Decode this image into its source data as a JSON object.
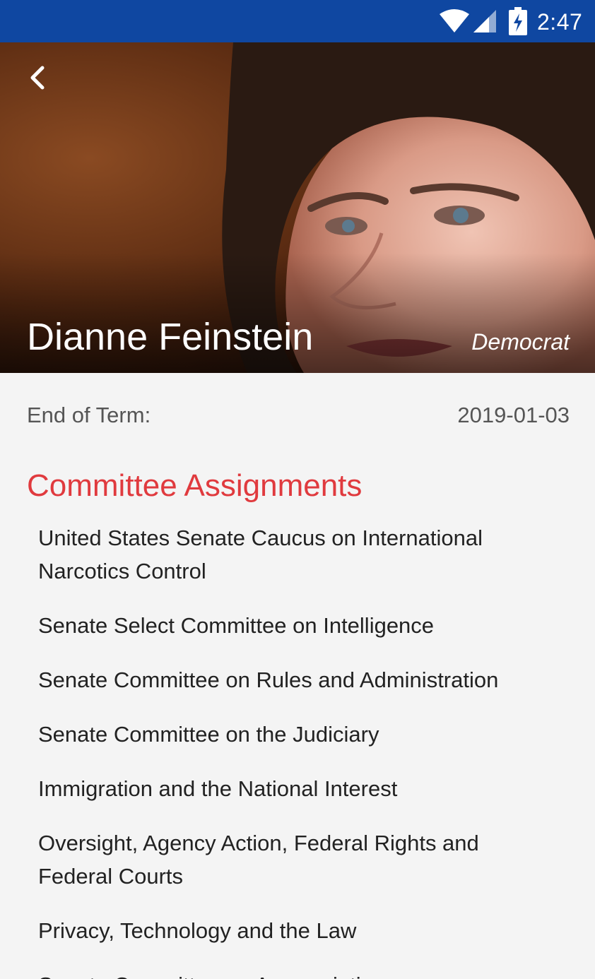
{
  "status_bar": {
    "time": "2:47",
    "icons": [
      "wifi-icon",
      "cell-signal-icon",
      "battery-charging-icon"
    ],
    "color": "#0f47a1"
  },
  "header": {
    "back_icon": "chevron-left-icon",
    "name": "Dianne Feinstein",
    "party": "Democrat"
  },
  "details": {
    "end_of_term_label": "End of Term:",
    "end_of_term_value": "2019-01-03"
  },
  "committees": {
    "title": "Committee Assignments",
    "title_color": "#e03a3e",
    "items": [
      "United States Senate Caucus on International Narcotics Control",
      "Senate Select Committee on Intelligence",
      "Senate Committee on Rules and Administration",
      "Senate Committee on the Judiciary",
      "Immigration and the National Interest",
      "Oversight, Agency Action, Federal Rights and Federal Courts",
      "Privacy, Technology and the Law",
      "Senate Committee on Appropriations"
    ]
  }
}
